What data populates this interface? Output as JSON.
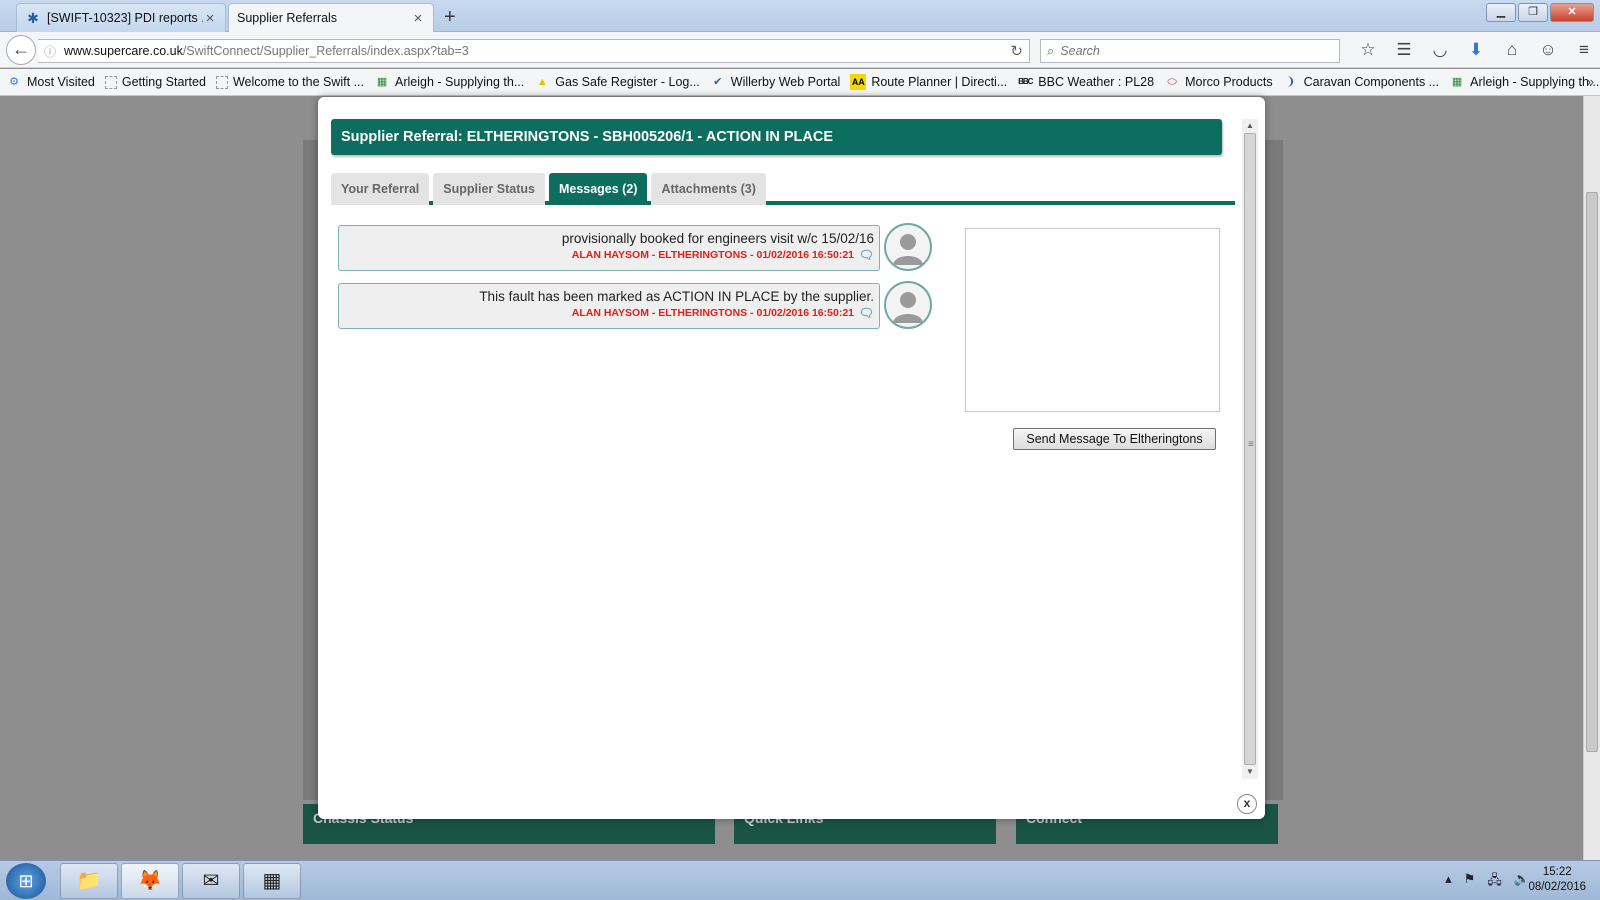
{
  "browser": {
    "tabs": [
      {
        "title": "[SWIFT-10323] PDI reports ...",
        "active": false
      },
      {
        "title": "Supplier Referrals",
        "active": true
      }
    ],
    "url_host": "www.supercare.co.uk",
    "url_path": "/SwiftConnect/Supplier_Referrals/index.aspx?tab=3",
    "search_placeholder": "Search",
    "bookmarks": [
      {
        "label": "Most Visited",
        "icon": "gear-icon"
      },
      {
        "label": "Getting Started",
        "icon": "page-icon"
      },
      {
        "label": "Welcome to the Swift ...",
        "icon": "page-icon"
      },
      {
        "label": "Arleigh - Supplying th...",
        "icon": "grid-icon"
      },
      {
        "label": "Gas Safe Register - Log...",
        "icon": "triangle-icon"
      },
      {
        "label": "Willerby Web Portal",
        "icon": "check-icon"
      },
      {
        "label": "Route Planner | Directi...",
        "icon": "aa-icon"
      },
      {
        "label": "BBC Weather : PL28",
        "icon": "bbc-icon"
      },
      {
        "label": "Morco Products",
        "icon": "oval-icon"
      },
      {
        "label": "Caravan Components ...",
        "icon": "swoosh-icon"
      },
      {
        "label": "Arleigh - Supplying th...",
        "icon": "grid-icon"
      }
    ]
  },
  "background_page": {
    "panels": [
      "Chassis Status",
      "Quick Links",
      "Connect"
    ]
  },
  "modal": {
    "title": "Supplier Referral: ELTHERINGTONS - SBH005206/1 - ACTION IN PLACE",
    "tabs": [
      {
        "label": "Your Referral",
        "active": false
      },
      {
        "label": "Supplier Status",
        "active": false
      },
      {
        "label": "Messages (2)",
        "active": true
      },
      {
        "label": "Attachments (3)",
        "active": false
      }
    ],
    "messages": [
      {
        "text": "provisionally booked for engineers visit w/c 15/02/16",
        "meta": "ALAN HAYSOM - ELTHERINGTONS - 01/02/2016 16:50:21"
      },
      {
        "text": "This fault has been marked as ACTION IN PLACE by the supplier.",
        "meta": "ALAN HAYSOM - ELTHERINGTONS - 01/02/2016 16:50:21"
      }
    ],
    "message_input_value": "",
    "send_button_label": "Send Message To Eltheringtons",
    "close_label": "x"
  },
  "taskbar": {
    "time": "15:22",
    "date": "08/02/2016"
  },
  "colors": {
    "accent": "#0d6e5f",
    "meta_red": "#e0201b"
  }
}
